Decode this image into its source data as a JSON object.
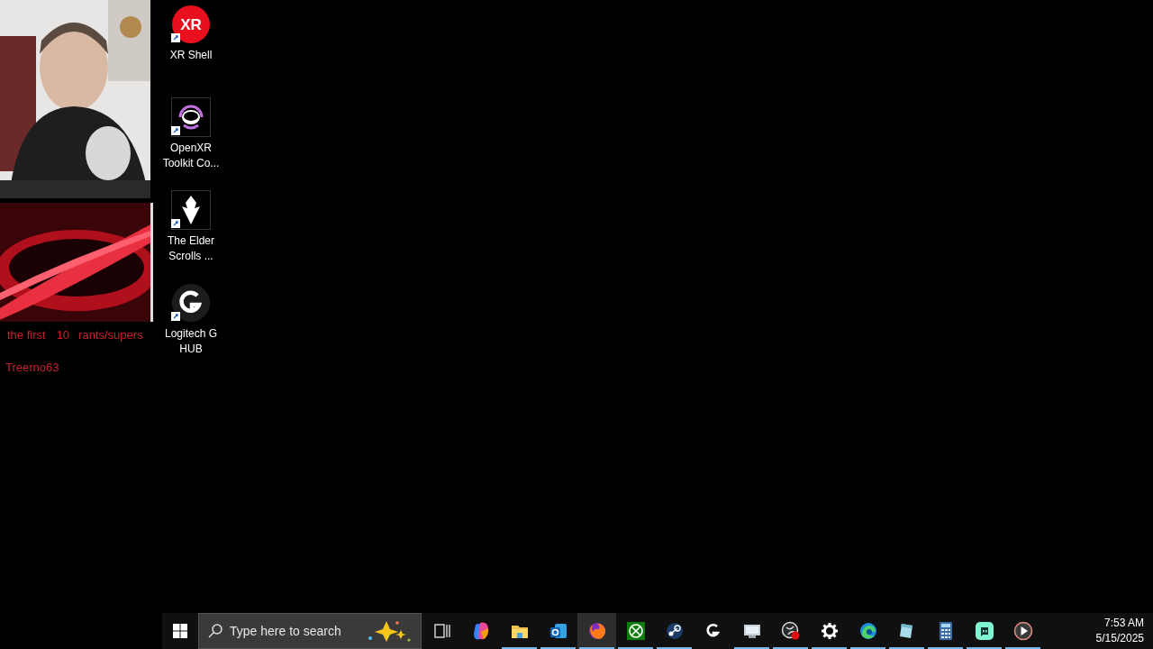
{
  "overlay": {
    "labels": [
      "the first",
      "10",
      "rants/supers"
    ],
    "username": "Treerno63"
  },
  "desktop_icons": [
    {
      "kind": "xr",
      "icon_text": "XR",
      "label": "XR Shell"
    },
    {
      "kind": "headset",
      "label": "OpenXR Toolkit Co..."
    },
    {
      "kind": "dragon",
      "label": "The Elder Scrolls ..."
    },
    {
      "kind": "g",
      "label": "Logitech G HUB"
    }
  ],
  "taskbar": {
    "search": {
      "placeholder": "Type here to search"
    },
    "apps": [
      {
        "kind": "taskview",
        "running": false,
        "active": false
      },
      {
        "kind": "copilot",
        "running": false,
        "active": false
      },
      {
        "kind": "folder",
        "running": true,
        "active": false
      },
      {
        "kind": "mail",
        "running": true,
        "active": false
      },
      {
        "kind": "firefox",
        "running": true,
        "active": true
      },
      {
        "kind": "xbox",
        "running": true,
        "active": false
      },
      {
        "kind": "steam",
        "running": true,
        "active": false
      },
      {
        "kind": "g",
        "running": false,
        "active": false
      },
      {
        "kind": "monitor",
        "running": true,
        "active": false
      },
      {
        "kind": "record",
        "running": true,
        "active": false
      },
      {
        "kind": "gear",
        "running": true,
        "active": false
      },
      {
        "kind": "edge",
        "running": true,
        "active": false
      },
      {
        "kind": "notepad",
        "running": true,
        "active": false
      },
      {
        "kind": "calculator",
        "running": true,
        "active": false
      },
      {
        "kind": "chat",
        "running": true,
        "active": false
      },
      {
        "kind": "play",
        "running": true,
        "active": false
      }
    ],
    "clock": {
      "time": "7:53 AM",
      "date": "5/15/2025"
    }
  }
}
